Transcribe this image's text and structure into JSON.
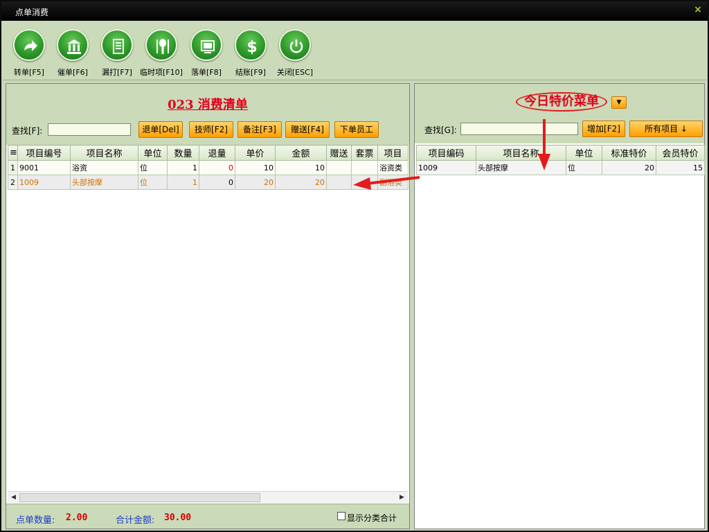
{
  "window": {
    "title": "点单消费",
    "close_glyph": "×"
  },
  "toolbar": {
    "buttons": [
      {
        "label": "转单[F5]",
        "icon": "transfer-icon"
      },
      {
        "label": "催单[F6]",
        "icon": "bank-icon"
      },
      {
        "label": "漏打[F7]",
        "icon": "document-icon"
      },
      {
        "label": "临时项[F10]",
        "icon": "utensils-icon"
      },
      {
        "label": "落单[F8]",
        "icon": "screen-icon"
      },
      {
        "label": "结账[F9]",
        "icon": "dollar-icon"
      },
      {
        "label": "关闭[ESC]",
        "icon": "power-icon"
      }
    ]
  },
  "left": {
    "title": "023 消费清单",
    "search_label": "查找[F]:",
    "search_value": "",
    "buttons": [
      "退单[Del]",
      "技师[F2]",
      "备注[F3]",
      "赠送[F4]",
      "下单员工"
    ],
    "columns": [
      "≡",
      "项目编号",
      "项目名称",
      "单位",
      "数量",
      "退量",
      "单价",
      "金额",
      "赠送",
      "套票",
      "项目"
    ],
    "rows": [
      {
        "idx": "1",
        "code": "9001",
        "name": "浴资",
        "unit": "位",
        "qty": "1",
        "ret": "0",
        "price": "10",
        "amount": "10",
        "gift": "",
        "ticket": "",
        "category": "浴资类"
      },
      {
        "idx": "2",
        "code": "1009",
        "name": "头部按摩",
        "unit": "位",
        "qty": "1",
        "ret": "0",
        "price": "20",
        "amount": "20",
        "gift": "",
        "ticket": "",
        "category": "副浴类"
      }
    ],
    "scroll_left": "◀",
    "scroll_right": "▶",
    "footer": {
      "count_label": "点单数量:",
      "count_value": "2.00",
      "total_label": "合计金额:",
      "total_value": "30.00",
      "checkbox_label": "显示分类合计"
    }
  },
  "right": {
    "title": "今日特价菜单",
    "dropdown_glyph": "▼",
    "search_label": "查找[G]:",
    "search_value": "",
    "add_button": "增加[F2]",
    "all_button": "所有项目 ↓",
    "columns": [
      "项目编码",
      "项目名称",
      "单位",
      "标准特价",
      "会员特价"
    ],
    "rows": [
      {
        "code": "1009",
        "name": "头部按摩",
        "unit": "位",
        "std": "20",
        "member": "15"
      }
    ]
  },
  "colors": {
    "accent_red": "#e0001b",
    "orange_button": "#ff9f00",
    "panel_green": "#cbdab9",
    "row_text_highlight": "#d07000",
    "footer_blue": "#1f3fc9"
  }
}
